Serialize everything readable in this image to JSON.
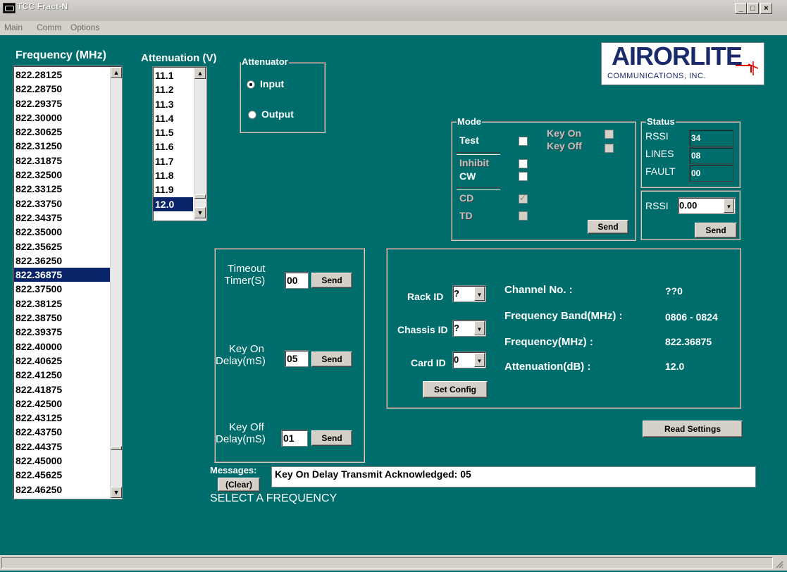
{
  "window": {
    "title": "TCC Fract-N",
    "minimize": "_",
    "maximize": "□",
    "close": "×"
  },
  "menu": [
    "Main",
    "Comm",
    "Options"
  ],
  "frequency": {
    "label": "Frequency (MHz)",
    "items": [
      "822.28125",
      "822.28750",
      "822.29375",
      "822.30000",
      "822.30625",
      "822.31250",
      "822.31875",
      "822.32500",
      "822.33125",
      "822.33750",
      "822.34375",
      "822.35000",
      "822.35625",
      "822.36250",
      "822.36875",
      "822.37500",
      "822.38125",
      "822.38750",
      "822.39375",
      "822.40000",
      "822.40625",
      "822.41250",
      "822.41875",
      "822.42500",
      "822.43125",
      "822.43750",
      "822.44375",
      "822.45000",
      "822.45625",
      "822.46250"
    ],
    "selected": "822.36875"
  },
  "attenuation": {
    "label": "Attenuation (V)",
    "items": [
      "11.1",
      "11.2",
      "11.3",
      "11.4",
      "11.5",
      "11.6",
      "11.7",
      "11.8",
      "11.9",
      "12.0"
    ],
    "selected": "12.0"
  },
  "attenuator": {
    "label": "Attenuator",
    "input": "Input",
    "output": "Output",
    "selected": "Input"
  },
  "logo": {
    "brand": "AIRORLITE",
    "sub": "COMMUNICATIONS, INC."
  },
  "mode": {
    "label": "Mode",
    "test": "Test",
    "inhibit": "Inhibit",
    "cw": "CW",
    "cd": "CD",
    "td": "TD",
    "key_on": "Key On",
    "key_off": "Key Off",
    "send": "Send"
  },
  "status": {
    "label": "Status",
    "rssi_label": "RSSI",
    "rssi_value": "34",
    "lines_label": "LINES",
    "lines_value": "08",
    "fault_label": "FAULT",
    "fault_value": "00"
  },
  "rssi": {
    "label": "RSSI",
    "value": "0.00",
    "send": "Send"
  },
  "timers": {
    "timeout_label1": "Timeout",
    "timeout_label2": "Timer(S)",
    "timeout_value": "00",
    "keyon_label1": "Key On",
    "keyon_label2": "Delay(mS)",
    "keyon_value": "05",
    "keyoff_label1": "Key Off",
    "keyoff_label2": "Delay(mS)",
    "keyoff_value": "01",
    "send": "Send"
  },
  "config": {
    "rack_label": "Rack ID",
    "rack_value": "?",
    "chassis_label": "Chassis ID",
    "chassis_value": "?",
    "card_label": "Card ID",
    "card_value": "0",
    "set_config": "Set Config",
    "channel_label": "Channel No. :",
    "channel_value": "??0",
    "band_label": "Frequency Band(MHz) :",
    "band_value": "0806 - 0824",
    "freq_label": "Frequency(MHz) :",
    "freq_value": "822.36875",
    "atten_label": "Attenuation(dB) :",
    "atten_value": "12.0"
  },
  "read_settings": "Read Settings",
  "messages": {
    "label": "Messages:",
    "clear": "(Clear)",
    "text": "Key On Delay Transmit Acknowledged: 05"
  },
  "prompt": "SELECT A FREQUENCY",
  "colors": {
    "background": "#006d6d",
    "selection": "#0a246a",
    "logo_red": "#e00000",
    "logo_navy": "#1a2a6a"
  }
}
